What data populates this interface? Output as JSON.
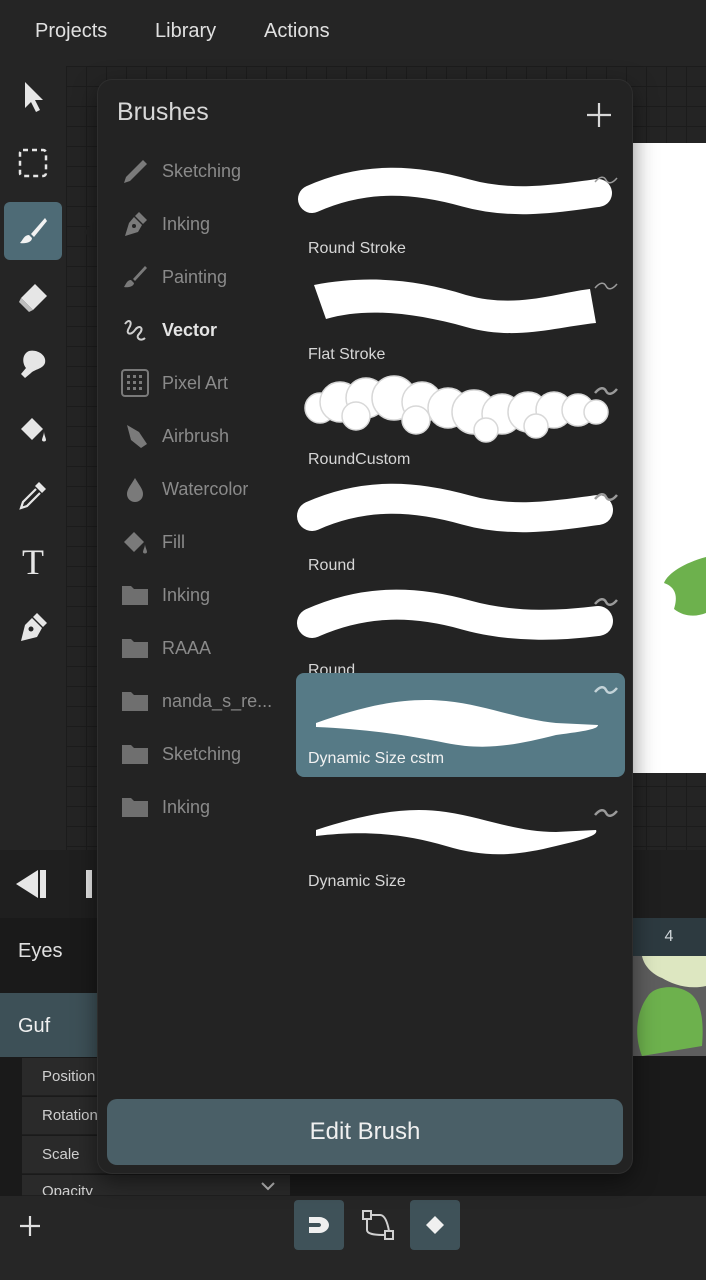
{
  "menu": {
    "projects": "Projects",
    "library": "Library",
    "actions": "Actions"
  },
  "tools": [
    {
      "icon": "select-arrow-icon"
    },
    {
      "icon": "marquee-selection-icon"
    },
    {
      "icon": "brush-icon",
      "active": true
    },
    {
      "icon": "eraser-icon"
    },
    {
      "icon": "smudge-icon"
    },
    {
      "icon": "fill-bucket-icon"
    },
    {
      "icon": "eyedropper-icon"
    },
    {
      "icon": "text-icon"
    },
    {
      "icon": "pen-nib-icon"
    }
  ],
  "brushes_panel": {
    "title": "Brushes",
    "categories": [
      {
        "label": "Sketching",
        "icon": "pencil-icon"
      },
      {
        "label": "Inking",
        "icon": "ink-pen-icon"
      },
      {
        "label": "Painting",
        "icon": "paint-brush-icon"
      },
      {
        "label": "Vector",
        "icon": "vector-squiggle-icon",
        "active": true
      },
      {
        "label": "Pixel Art",
        "icon": "pixel-grid-icon"
      },
      {
        "label": "Airbrush",
        "icon": "airbrush-icon"
      },
      {
        "label": "Watercolor",
        "icon": "water-drop-icon"
      },
      {
        "label": "Fill",
        "icon": "fill-bucket-icon"
      },
      {
        "label": "Inking",
        "icon": "folder-icon"
      },
      {
        "label": "RAAA",
        "icon": "folder-icon"
      },
      {
        "label": "nanda_s_re...",
        "icon": "folder-icon"
      },
      {
        "label": "Sketching",
        "icon": "folder-icon"
      },
      {
        "label": "Inking",
        "icon": "folder-icon"
      }
    ],
    "brushes": [
      {
        "name": "Round Stroke"
      },
      {
        "name": "Flat Stroke"
      },
      {
        "name": "RoundCustom"
      },
      {
        "name": "Round"
      },
      {
        "name": "Round"
      },
      {
        "name": "Dynamic Size cstm",
        "selected": true
      },
      {
        "name": "Dynamic Size"
      }
    ],
    "edit_button": "Edit Brush"
  },
  "timeline": {
    "frame_number": "4"
  },
  "layers": {
    "eyes": "Eyes",
    "guf": "Guf"
  },
  "properties": {
    "position": "Position",
    "rotation": "Rotation",
    "scale": "Scale",
    "opacity": "Opacity"
  },
  "colors": {
    "accent": "#567a86",
    "button": "#4a5f67",
    "artwork_green": "#6db14d"
  }
}
